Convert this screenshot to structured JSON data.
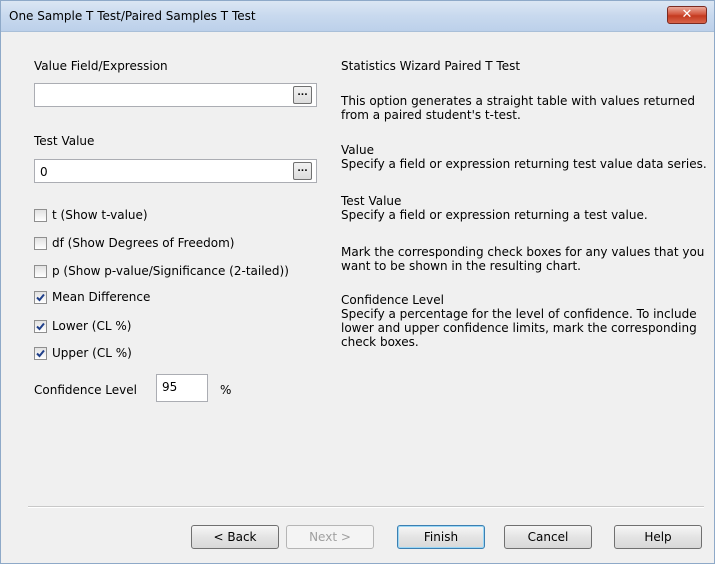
{
  "window": {
    "title": "One Sample T Test/Paired Samples T Test",
    "close_glyph": "✕"
  },
  "form": {
    "value_field_label": "Value Field/Expression",
    "value_field_value": "",
    "test_value_label": "Test Value",
    "test_value_value": "0",
    "ellipsis": "...",
    "checkboxes": [
      {
        "label": "t (Show t-value)",
        "checked": false
      },
      {
        "label": "df (Show Degrees of Freedom)",
        "checked": false
      },
      {
        "label": "p (Show p-value/Significance (2-tailed))",
        "checked": false
      },
      {
        "label": "Mean Difference",
        "checked": true
      },
      {
        "label": "Lower (CL %)",
        "checked": true
      },
      {
        "label": "Upper (CL %)",
        "checked": true
      }
    ],
    "confidence_label": "Confidence Level",
    "confidence_value": "95",
    "confidence_unit": "%"
  },
  "help": {
    "heading": "Statistics Wizard Paired T Test",
    "intro": "This option generates a straight table with values returned\nfrom a paired student's t-test.",
    "value_title": "Value",
    "value_text": "Specify a field or expression returning test value data series.",
    "test_value_title": "Test Value",
    "test_value_text": "Specify a field or expression returning a test value.",
    "checkbox_text": "Mark the corresponding check boxes for any values that you\nwant to be shown in the resulting chart.",
    "confidence_title": "Confidence Level",
    "confidence_text": "Specify a percentage for the level of confidence. To include\nlower and upper confidence limits, mark the corresponding\ncheck boxes."
  },
  "buttons": {
    "back": "< Back",
    "next": "Next >",
    "finish": "Finish",
    "cancel": "Cancel",
    "help": "Help"
  }
}
